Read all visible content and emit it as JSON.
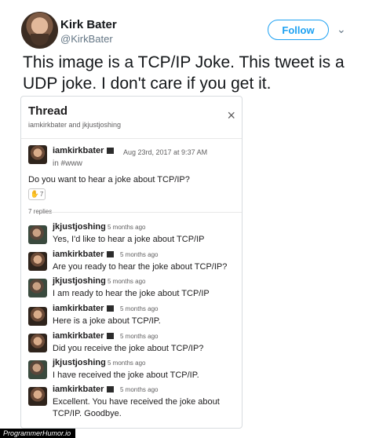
{
  "tweet": {
    "author_name": "Kirk Bater",
    "author_handle": "@KirkBater",
    "follow_label": "Follow",
    "text": "This image is a TCP/IP Joke.  This tweet is a UDP joke.  I don't care if you get it."
  },
  "thread": {
    "title": "Thread",
    "participants": "iamkirkbater and jkjustjoshing",
    "first_message": {
      "name": "iamkirkbater",
      "timestamp": "Aug 23rd, 2017 at 9:37 AM",
      "channel": "in #www",
      "text": "Do you want to hear a joke about TCP/IP?",
      "reaction_count": "7"
    },
    "replies_label": "7 replies",
    "replies": [
      {
        "name": "jkjustjoshing",
        "time": "5 months ago",
        "text": "Yes, I'd like to hear a joke about TCP/IP"
      },
      {
        "name": "iamkirkbater",
        "time": "5 months ago",
        "text": "Are you ready to hear the joke about TCP/IP?"
      },
      {
        "name": "jkjustjoshing",
        "time": "5 months ago",
        "text": "I am ready to hear the joke about TCP/IP"
      },
      {
        "name": "iamkirkbater",
        "time": "5 months ago",
        "text": "Here is a joke about TCP/IP."
      },
      {
        "name": "iamkirkbater",
        "time": "5 months ago",
        "text": "Did you receive the joke about TCP/IP?"
      },
      {
        "name": "jkjustjoshing",
        "time": "5 months ago",
        "text": "I have received the joke about TCP/IP."
      },
      {
        "name": "iamkirkbater",
        "time": "5 months ago",
        "text": "Excellent.  You have received the joke about TCP/IP.  Goodbye."
      }
    ]
  },
  "watermark": "ProgrammerHumor.io",
  "colors": {
    "accent": "#1da1f2"
  }
}
